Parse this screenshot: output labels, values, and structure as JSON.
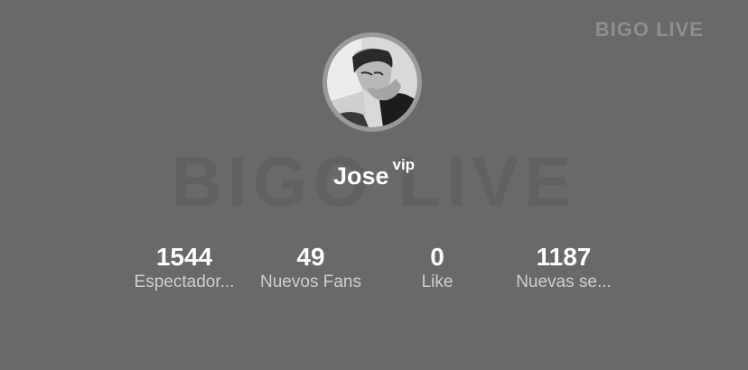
{
  "brand": {
    "corner_logo": "BIGO LIVE",
    "watermark": "BIGO LIVE"
  },
  "profile": {
    "avatar_icon": "user-avatar-photo",
    "name": "Jose",
    "badge": "vip"
  },
  "stats": [
    {
      "value": "1544",
      "label": "Espectador..."
    },
    {
      "value": "49",
      "label": "Nuevos Fans"
    },
    {
      "value": "0",
      "label": "Like"
    },
    {
      "value": "1187",
      "label": "Nuevas se..."
    }
  ],
  "colors": {
    "background": "#69696b",
    "value_text": "#ffffff",
    "label_text": "#cfcfd1",
    "logo_text": "#8e8e90"
  }
}
